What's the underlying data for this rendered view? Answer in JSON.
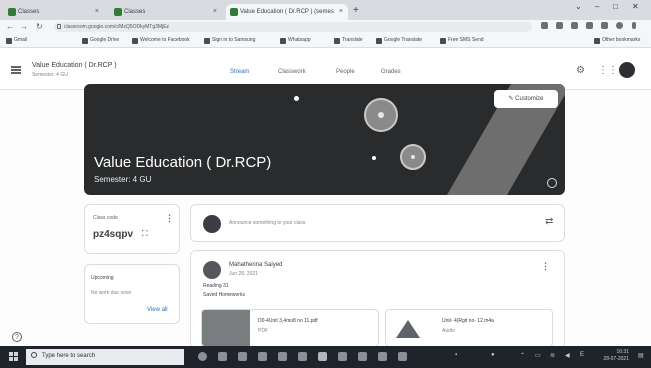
{
  "browser": {
    "tabs": [
      {
        "label": "Classes",
        "active": false
      },
      {
        "label": "Classes",
        "active": false
      },
      {
        "label": "Value Education ( Dr.RCP ) (semes",
        "active": true
      }
    ],
    "url": "classroom.google.com/c/MzQ5ODkyMTg3MjEz",
    "bookmarks": [
      "Gmail",
      "Google Drive",
      "Welcome to Facebook",
      "Sign in to Samsung",
      "Whatsapp",
      "Translate",
      "Google Translate",
      "Free SMS Send",
      "Other bookmarks"
    ]
  },
  "classroom": {
    "class_title": "Value Education ( Dr.RCP )",
    "class_subtitle": "Semester: 4 GU",
    "tabs": [
      "Stream",
      "Classwork",
      "People",
      "Grades"
    ],
    "active_tab": "Stream"
  },
  "banner": {
    "title": "Value Education ( Dr.RCP)",
    "semester": "Semester: 4 GU",
    "customize_label": "Customize"
  },
  "class_code_card": {
    "label": "Class code",
    "code": "pz4sqpv"
  },
  "upcoming_card": {
    "label": "Upcoming",
    "text": "No work due soon",
    "view_all": "View all"
  },
  "announce": {
    "placeholder": "Announce something to your class"
  },
  "post": {
    "author": "Mahathenna Saiyed",
    "date": "Jun 28, 2021",
    "lines": [
      "Reading 31",
      "Saved Homeworks"
    ],
    "attachments": [
      {
        "name": "D0-4Unit 3,4mo8 no 11.pdf",
        "type": "PDF"
      },
      {
        "name": "Unit- 4(Rgit no- 12.m4a",
        "type": "Audio"
      }
    ]
  },
  "taskbar": {
    "search_placeholder": "Type here to search",
    "time": "16:31",
    "date": "28-07-2021"
  }
}
